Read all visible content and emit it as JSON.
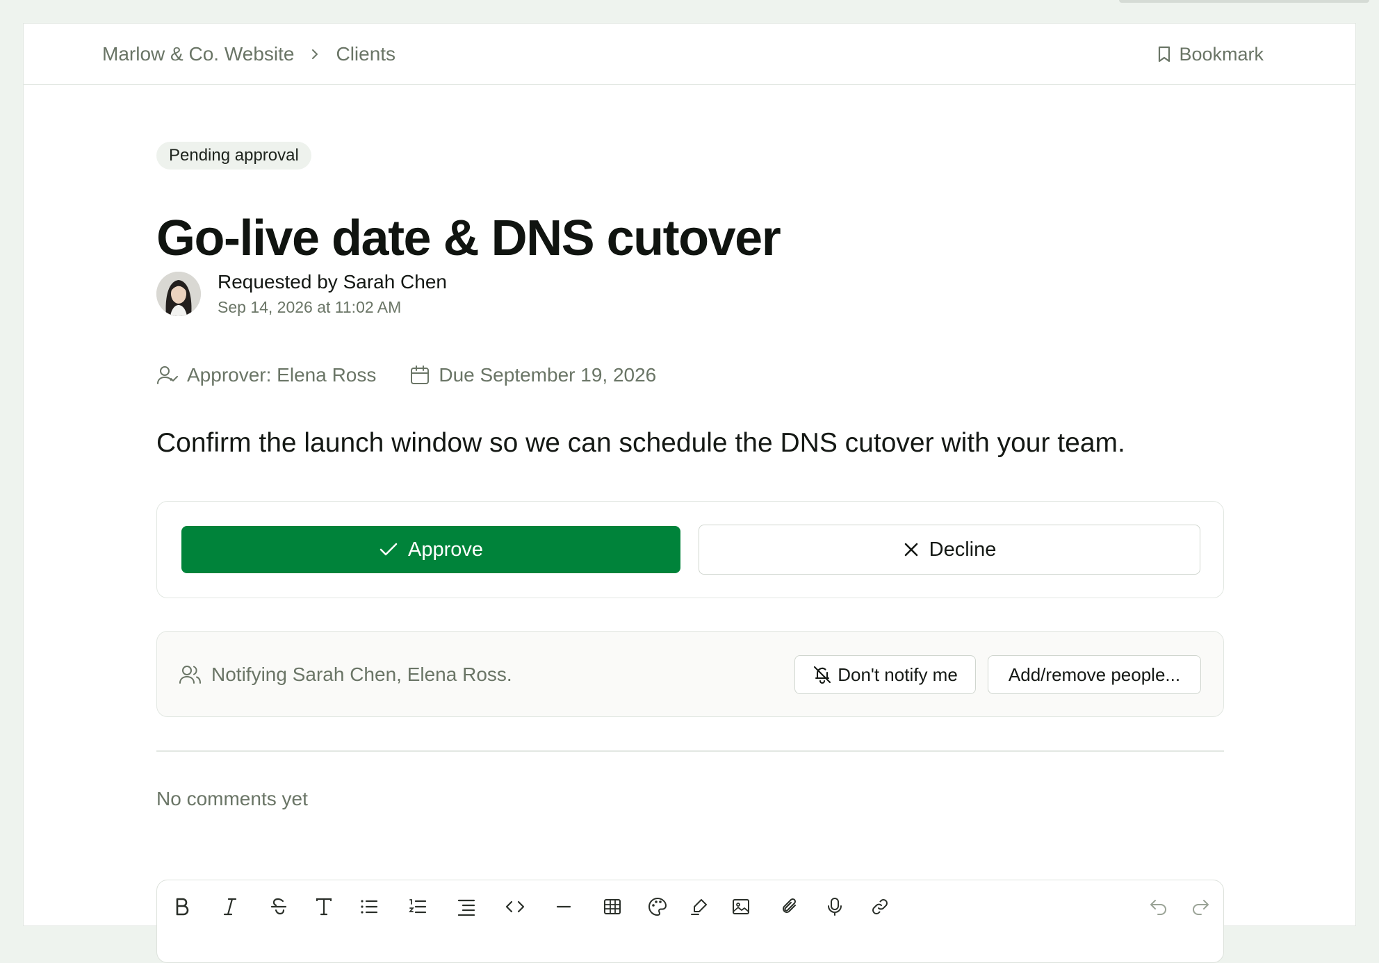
{
  "breadcrumb": {
    "items": [
      "Marlow & Co. Website",
      "Clients"
    ],
    "bookmark_label": "Bookmark"
  },
  "request": {
    "status": "Pending approval",
    "title": "Go-live date & DNS cutover",
    "requested_by": "Requested by Sarah Chen",
    "requested_at": "Sep 14, 2026 at 11:02 AM",
    "approver": "Approver: Elena Ross",
    "due": "Due September 19, 2026",
    "description": "Confirm the launch window so we can schedule the DNS cutover with your team."
  },
  "actions": {
    "approve_label": "Approve",
    "decline_label": "Decline"
  },
  "notify": {
    "text": "Notifying Sarah Chen, Elena Ross.",
    "dont_notify_label": "Don't notify me",
    "add_remove_label": "Add/remove people..."
  },
  "comments": {
    "empty_text": "No comments yet"
  },
  "editor_toolbar": {
    "tools": [
      "bold-icon",
      "italic-icon",
      "strikethrough-icon",
      "text-size-icon",
      "bullet-list-icon",
      "numbered-list-icon",
      "indent-icon",
      "code-icon",
      "divider-icon",
      "table-icon",
      "palette-icon",
      "highlight-icon",
      "image-icon",
      "attachment-icon",
      "microphone-icon",
      "link-icon",
      "undo-icon",
      "redo-icon"
    ]
  },
  "colors": {
    "approve": "#00833a",
    "muted_text": "#6a7566",
    "background": "#eef3ee"
  }
}
